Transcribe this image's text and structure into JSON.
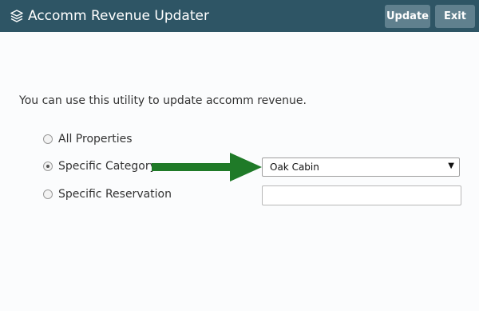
{
  "header": {
    "title": "Accomm Revenue Updater",
    "icon": "layers-icon",
    "update_label": "Update",
    "exit_label": "Exit"
  },
  "intro_text": "You can use this utility to update accomm revenue.",
  "options": [
    {
      "label": "All Properties",
      "selected": false
    },
    {
      "label": "Specific Category",
      "selected": true
    },
    {
      "label": "Specific Reservation",
      "selected": false
    }
  ],
  "category_select": {
    "selected_value": "Oak Cabin"
  },
  "reservation_input": {
    "value": "",
    "placeholder": ""
  },
  "colors": {
    "header_bg": "#2e5565",
    "button_bg": "#60808e",
    "annotation_arrow": "#1f7a28"
  }
}
